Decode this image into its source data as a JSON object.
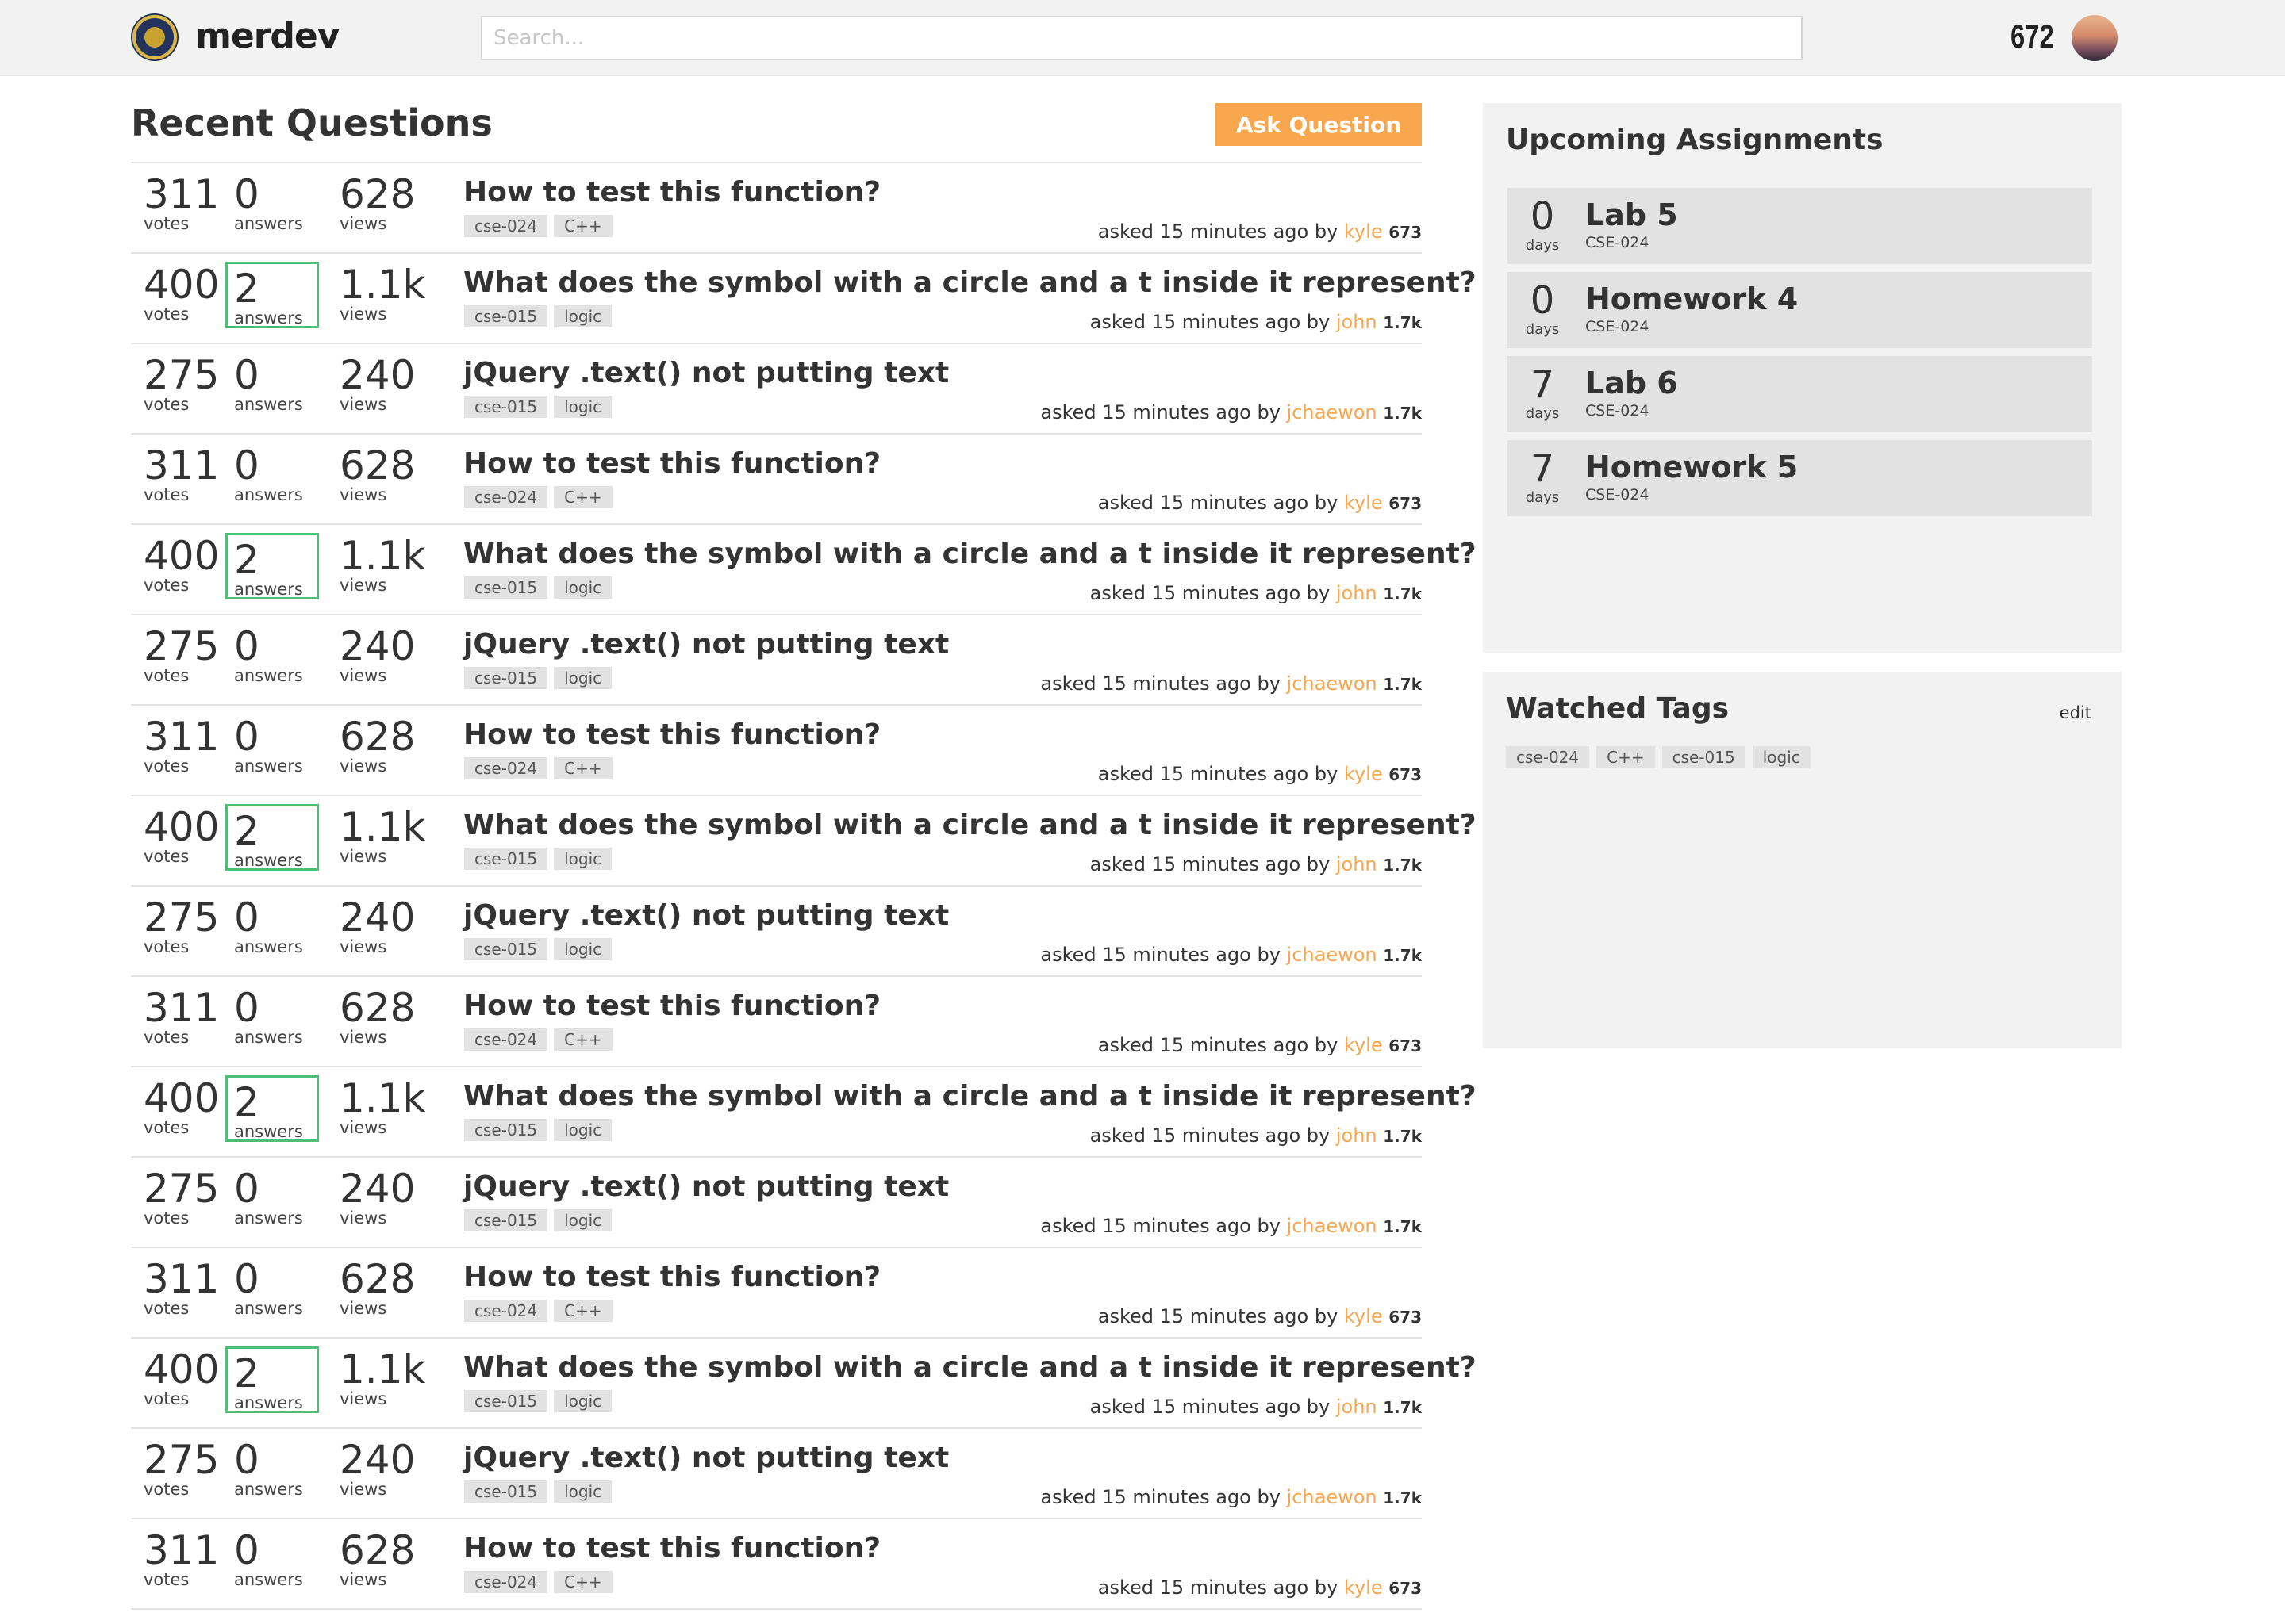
{
  "header": {
    "brand": "merdev",
    "search_placeholder": "Search...",
    "reputation": "672"
  },
  "main": {
    "title": "Recent Questions",
    "ask_button": "Ask Question",
    "labels": {
      "votes": "votes",
      "answers": "answers",
      "views": "views"
    },
    "questions": [
      {
        "votes": "311",
        "answers": "0",
        "views": "628",
        "answered": false,
        "title": "How to test this function?",
        "tags": [
          "cse-024",
          "C++"
        ],
        "asked": "asked 15 minutes ago by",
        "user": "kyle",
        "user_rep": "673"
      },
      {
        "votes": "400",
        "answers": "2",
        "views": "1.1k",
        "answered": true,
        "title": "What does the symbol with a circle and a t inside it represent?",
        "tags": [
          "cse-015",
          "logic"
        ],
        "asked": "asked 15 minutes ago by",
        "user": "john",
        "user_rep": "1.7k"
      },
      {
        "votes": "275",
        "answers": "0",
        "views": "240",
        "answered": false,
        "title": "jQuery .text() not putting text",
        "tags": [
          "cse-015",
          "logic"
        ],
        "asked": "asked 15 minutes ago by",
        "user": "jchaewon",
        "user_rep": "1.7k"
      },
      {
        "votes": "311",
        "answers": "0",
        "views": "628",
        "answered": false,
        "title": "How to test this function?",
        "tags": [
          "cse-024",
          "C++"
        ],
        "asked": "asked 15 minutes ago by",
        "user": "kyle",
        "user_rep": "673"
      },
      {
        "votes": "400",
        "answers": "2",
        "views": "1.1k",
        "answered": true,
        "title": "What does the symbol with a circle and a t inside it represent?",
        "tags": [
          "cse-015",
          "logic"
        ],
        "asked": "asked 15 minutes ago by",
        "user": "john",
        "user_rep": "1.7k"
      },
      {
        "votes": "275",
        "answers": "0",
        "views": "240",
        "answered": false,
        "title": "jQuery .text() not putting text",
        "tags": [
          "cse-015",
          "logic"
        ],
        "asked": "asked 15 minutes ago by",
        "user": "jchaewon",
        "user_rep": "1.7k"
      },
      {
        "votes": "311",
        "answers": "0",
        "views": "628",
        "answered": false,
        "title": "How to test this function?",
        "tags": [
          "cse-024",
          "C++"
        ],
        "asked": "asked 15 minutes ago by",
        "user": "kyle",
        "user_rep": "673"
      },
      {
        "votes": "400",
        "answers": "2",
        "views": "1.1k",
        "answered": true,
        "title": "What does the symbol with a circle and a t inside it represent?",
        "tags": [
          "cse-015",
          "logic"
        ],
        "asked": "asked 15 minutes ago by",
        "user": "john",
        "user_rep": "1.7k"
      },
      {
        "votes": "275",
        "answers": "0",
        "views": "240",
        "answered": false,
        "title": "jQuery .text() not putting text",
        "tags": [
          "cse-015",
          "logic"
        ],
        "asked": "asked 15 minutes ago by",
        "user": "jchaewon",
        "user_rep": "1.7k"
      },
      {
        "votes": "311",
        "answers": "0",
        "views": "628",
        "answered": false,
        "title": "How to test this function?",
        "tags": [
          "cse-024",
          "C++"
        ],
        "asked": "asked 15 minutes ago by",
        "user": "kyle",
        "user_rep": "673"
      },
      {
        "votes": "400",
        "answers": "2",
        "views": "1.1k",
        "answered": true,
        "title": "What does the symbol with a circle and a t inside it represent?",
        "tags": [
          "cse-015",
          "logic"
        ],
        "asked": "asked 15 minutes ago by",
        "user": "john",
        "user_rep": "1.7k"
      },
      {
        "votes": "275",
        "answers": "0",
        "views": "240",
        "answered": false,
        "title": "jQuery .text() not putting text",
        "tags": [
          "cse-015",
          "logic"
        ],
        "asked": "asked 15 minutes ago by",
        "user": "jchaewon",
        "user_rep": "1.7k"
      },
      {
        "votes": "311",
        "answers": "0",
        "views": "628",
        "answered": false,
        "title": "How to test this function?",
        "tags": [
          "cse-024",
          "C++"
        ],
        "asked": "asked 15 minutes ago by",
        "user": "kyle",
        "user_rep": "673"
      },
      {
        "votes": "400",
        "answers": "2",
        "views": "1.1k",
        "answered": true,
        "title": "What does the symbol with a circle and a t inside it represent?",
        "tags": [
          "cse-015",
          "logic"
        ],
        "asked": "asked 15 minutes ago by",
        "user": "john",
        "user_rep": "1.7k"
      },
      {
        "votes": "275",
        "answers": "0",
        "views": "240",
        "answered": false,
        "title": "jQuery .text() not putting text",
        "tags": [
          "cse-015",
          "logic"
        ],
        "asked": "asked 15 minutes ago by",
        "user": "jchaewon",
        "user_rep": "1.7k"
      },
      {
        "votes": "311",
        "answers": "0",
        "views": "628",
        "answered": false,
        "title": "How to test this function?",
        "tags": [
          "cse-024",
          "C++"
        ],
        "asked": "asked 15 minutes ago by",
        "user": "kyle",
        "user_rep": "673"
      }
    ]
  },
  "sidebar": {
    "assignments_title": "Upcoming Assignments",
    "days_label": "days",
    "assignments": [
      {
        "days": "0",
        "name": "Lab 5",
        "course": "CSE-024"
      },
      {
        "days": "0",
        "name": "Homework 4",
        "course": "CSE-024"
      },
      {
        "days": "7",
        "name": "Lab 6",
        "course": "CSE-024"
      },
      {
        "days": "7",
        "name": "Homework 5",
        "course": "CSE-024"
      }
    ],
    "tags_title": "Watched Tags",
    "edit_label": "edit",
    "watched_tags": [
      "cse-024",
      "C++",
      "cse-015",
      "logic"
    ]
  },
  "colors": {
    "accent": "#f8a74f",
    "answered_border": "#4bbf73",
    "panel_bg": "#f2f2f2",
    "tag_bg": "#e2e2e2"
  },
  "icons": {
    "logo": "university-seal-icon",
    "avatar": "user-avatar"
  }
}
